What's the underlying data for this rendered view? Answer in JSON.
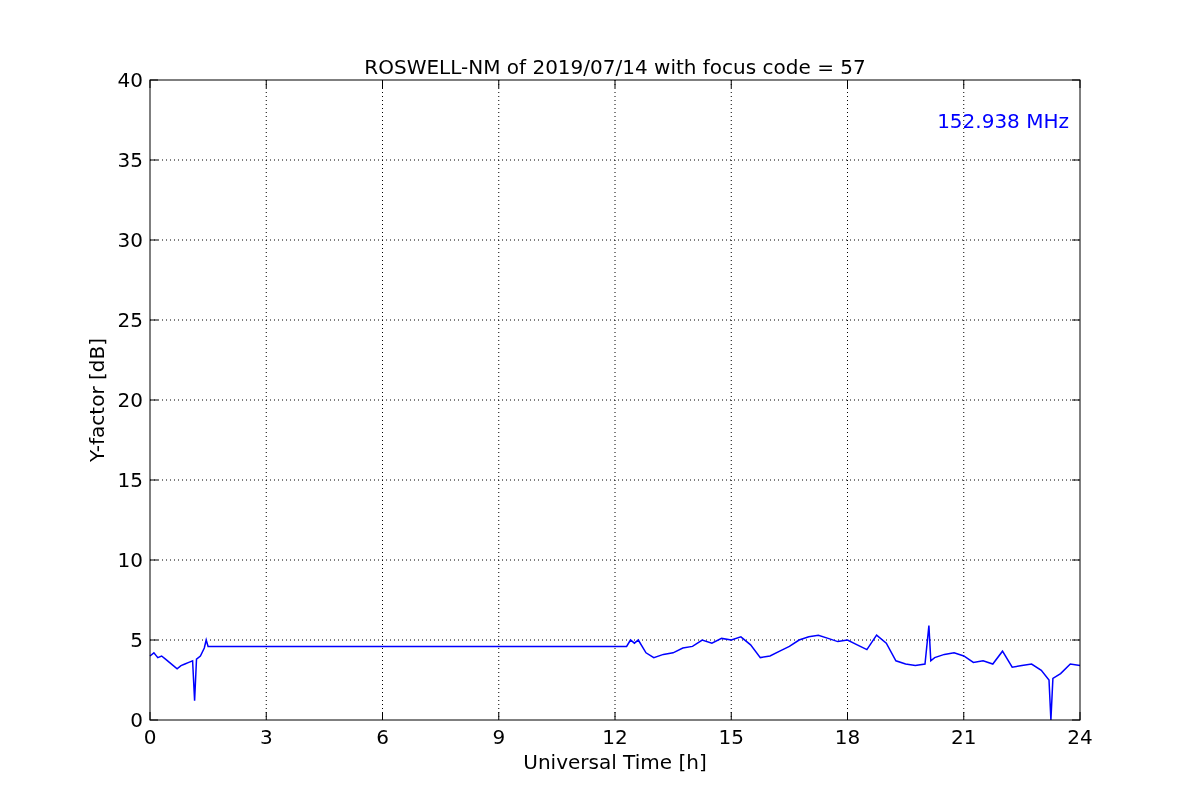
{
  "figure": {
    "chart_data": {
      "type": "line",
      "title": "ROSWELL-NM of 2019/07/14 with focus code = 57",
      "xlabel": "Universal Time [h]",
      "ylabel": "Y-factor [dB]",
      "xlim": [
        0,
        24
      ],
      "ylim": [
        0,
        40
      ],
      "xticks": [
        0,
        3,
        6,
        9,
        12,
        15,
        18,
        21,
        24
      ],
      "yticks": [
        0,
        5,
        10,
        15,
        20,
        25,
        30,
        35,
        40
      ],
      "x": [
        0,
        0.1,
        0.2,
        0.3,
        0.4,
        0.5,
        0.6,
        0.7,
        0.8,
        0.9,
        1.0,
        1.1,
        1.15,
        1.2,
        1.3,
        1.4,
        1.45,
        1.5,
        12.3,
        12.4,
        12.5,
        12.6,
        12.8,
        13.0,
        13.25,
        13.5,
        13.75,
        14.0,
        14.25,
        14.5,
        14.75,
        15.0,
        15.25,
        15.5,
        15.75,
        16.0,
        16.25,
        16.5,
        16.75,
        17.0,
        17.25,
        17.5,
        17.75,
        18.0,
        18.25,
        18.5,
        18.75,
        19.0,
        19.25,
        19.5,
        19.75,
        20.0,
        20.1,
        20.15,
        20.25,
        20.5,
        20.75,
        21.0,
        21.25,
        21.5,
        21.75,
        22.0,
        22.25,
        22.5,
        22.75,
        23.0,
        23.2,
        23.25,
        23.3,
        23.5,
        23.75,
        24.0
      ],
      "series": [
        {
          "color": "#0000ff",
          "values": [
            4.0,
            4.2,
            3.9,
            4.0,
            3.8,
            3.6,
            3.4,
            3.2,
            3.4,
            3.5,
            3.6,
            3.7,
            1.2,
            3.8,
            4.0,
            4.5,
            5.0,
            4.6,
            4.6,
            5.0,
            4.8,
            5.0,
            4.2,
            3.9,
            4.1,
            4.2,
            4.5,
            4.6,
            5.0,
            4.8,
            5.1,
            5.0,
            5.2,
            4.7,
            3.9,
            4.0,
            4.3,
            4.6,
            5.0,
            5.2,
            5.3,
            5.1,
            4.9,
            5.0,
            4.7,
            4.4,
            5.3,
            4.8,
            3.7,
            3.5,
            3.4,
            3.5,
            5.9,
            3.7,
            3.9,
            4.1,
            4.2,
            4.0,
            3.6,
            3.7,
            3.5,
            4.3,
            3.3,
            3.4,
            3.5,
            3.1,
            2.5,
            0.0,
            2.6,
            2.9,
            3.5,
            3.4
          ]
        }
      ],
      "grid": true,
      "annotations": [
        {
          "text": "152.938 MHz"
        }
      ]
    }
  }
}
